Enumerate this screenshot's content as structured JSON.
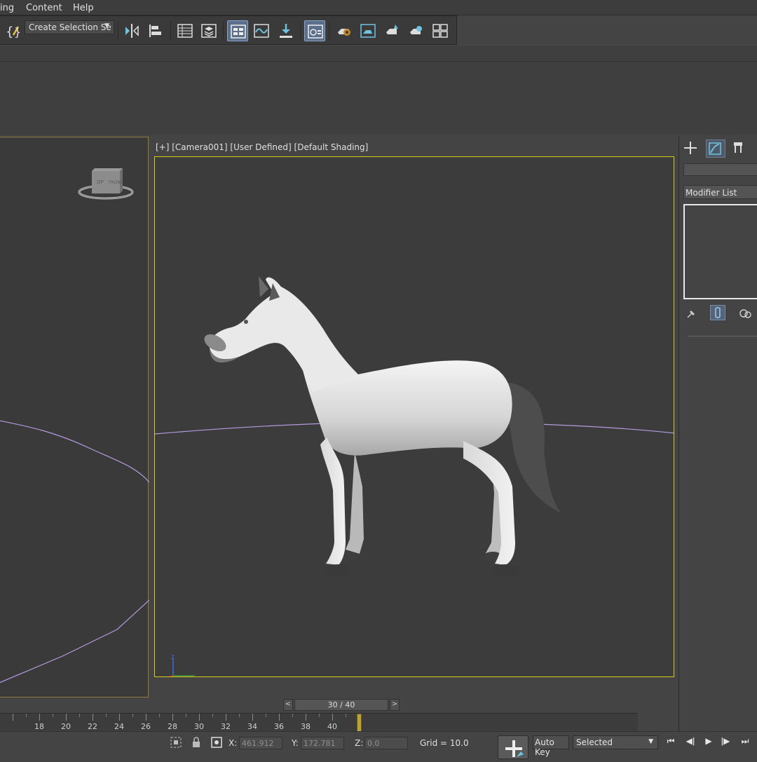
{
  "menu": {
    "items": [
      "ing",
      "Content",
      "Help"
    ]
  },
  "toolbar": {
    "selection_set": "Create Selection Se",
    "icons": [
      "curly-brace-wand-icon",
      "mirror-icon",
      "align-icon",
      "scene-explorer-icon",
      "layer-explorer-icon",
      "ribbon-toggle-icon",
      "curve-editor-icon",
      "schematic-view-icon",
      "material-editor-icon",
      "render-setup-icon",
      "rendered-frame-icon",
      "render-production-icon",
      "render-activeshade-icon",
      "render-gallery-icon"
    ]
  },
  "viewport": {
    "camera_label": "[+] [Camera001] [User Defined] [Default Shading]",
    "axis_z": "z",
    "axis_y": "y",
    "active_border_color": "#d7cc1c",
    "left_border_color": "#8f7b38"
  },
  "command_panel": {
    "modifier_list": "Modifier List",
    "tabs": [
      "create-icon",
      "modify-icon",
      "hierarchy-icon"
    ]
  },
  "time_slider": {
    "frame": "30 / 40",
    "prev": "<",
    "next": ">"
  },
  "trackbar": {
    "labels": [
      "18",
      "20",
      "22",
      "24",
      "26",
      "28",
      "30",
      "32",
      "34",
      "36",
      "38",
      "40"
    ],
    "current": "30"
  },
  "status": {
    "x_label": "X:",
    "x_value": "461.912",
    "y_label": "Y:",
    "y_value": "172.781",
    "z_label": "Z:",
    "z_value": "0.0",
    "grid": "Grid = 10.0",
    "auto_key": "Auto Key",
    "key_filter": "Selected"
  }
}
